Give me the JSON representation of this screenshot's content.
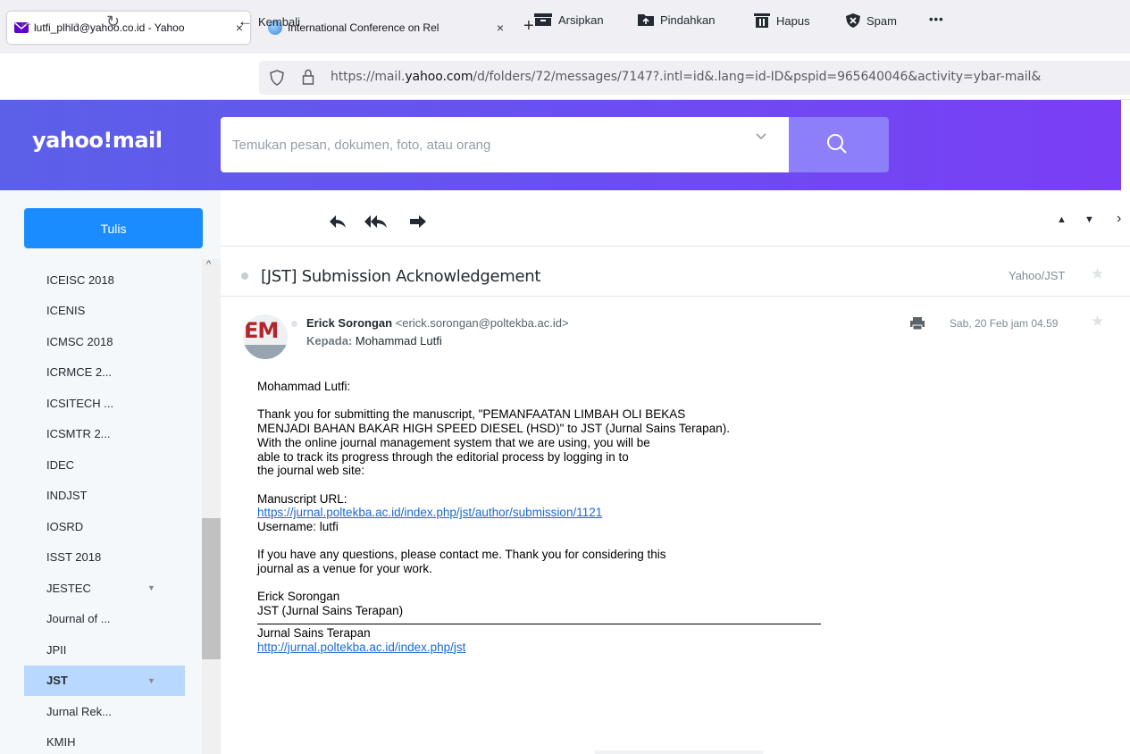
{
  "browser": {
    "tabs": [
      {
        "label": "lutfi_plhld@yahoo.co.id - Yahoo",
        "active": true,
        "icon": "mail-icon"
      },
      {
        "label": "International Conference on Rel",
        "active": false,
        "icon": "globe-icon"
      }
    ],
    "close_glyph": "×",
    "newtab_glyph": "+",
    "url_prefix": "https://mail.",
    "url_domain": "yahoo.com",
    "url_rest": "/d/folders/72/messages/7147?.intl=id&.lang=id-ID&pspid=965640046&activity=ybar-mail&"
  },
  "header": {
    "logo": "yahoo!mail",
    "search_placeholder": "Temukan pesan, dokumen, foto, atau orang",
    "brand_color": "#6a4ff0"
  },
  "sidebar": {
    "compose_label": "Tulis",
    "folders": [
      {
        "label": "ICEISC 2018",
        "caret": false,
        "selected": false
      },
      {
        "label": "ICENIS",
        "caret": false,
        "selected": false
      },
      {
        "label": "ICMSC 2018",
        "caret": false,
        "selected": false
      },
      {
        "label": "ICRMCE 2...",
        "caret": false,
        "selected": false
      },
      {
        "label": "ICSITECH ...",
        "caret": false,
        "selected": false
      },
      {
        "label": "ICSMTR 2...",
        "caret": false,
        "selected": false
      },
      {
        "label": "IDEC",
        "caret": false,
        "selected": false
      },
      {
        "label": "INDJST",
        "caret": false,
        "selected": false
      },
      {
        "label": "IOSRD",
        "caret": false,
        "selected": false
      },
      {
        "label": "ISST 2018",
        "caret": false,
        "selected": false
      },
      {
        "label": "JESTEC",
        "caret": true,
        "selected": false
      },
      {
        "label": "Journal of ...",
        "caret": false,
        "selected": false
      },
      {
        "label": "JPII",
        "caret": false,
        "selected": false
      },
      {
        "label": "JST",
        "caret": true,
        "selected": true
      },
      {
        "label": "Jurnal Rek...",
        "caret": false,
        "selected": false
      },
      {
        "label": "KMIH",
        "caret": false,
        "selected": false
      }
    ]
  },
  "toolbar": {
    "back_label": "Kembali",
    "archive_label": "Arsipkan",
    "move_label": "Pindahkan",
    "delete_label": "Hapus",
    "spam_label": "Spam",
    "more_label": "•••"
  },
  "message": {
    "subject": "[JST] Submission Acknowledgement",
    "folder": "Yahoo/JST",
    "avatar_initials": "EM",
    "from_name": "Erick Sorongan",
    "from_email": "<erick.sorongan@poltekba.ac.id>",
    "to_label": "Kepada:",
    "to_name": "Mohammad Lutfi",
    "date": "Sab, 20 Feb jam 04.59",
    "greeting": "Mohammad Lutfi:",
    "paragraph1": "Thank you for submitting the manuscript, \"PEMANFAATAN LIMBAH OLI BEKAS\nMENJADI BAHAN BAKAR HIGH SPEED DIESEL (HSD)\" to JST (Jurnal Sains Terapan).\nWith the online journal management system that we are using, you will be\nable to track its progress through the editorial process by logging in to\nthe journal web site:",
    "manuscript_label": "Manuscript URL:",
    "manuscript_url": "https://jurnal.poltekba.ac.id/index.php/jst/author/submission/1121",
    "username_line": "Username: lutfi",
    "paragraph2": "If you have any questions, please contact me. Thank you for considering this\njournal as a venue for your work.",
    "sig_name": "Erick Sorongan",
    "sig_journal": "JST (Jurnal Sains Terapan)",
    "footer_title": "Jurnal Sains Terapan",
    "footer_url": "http://jurnal.poltekba.ac.id/index.php/jst"
  }
}
